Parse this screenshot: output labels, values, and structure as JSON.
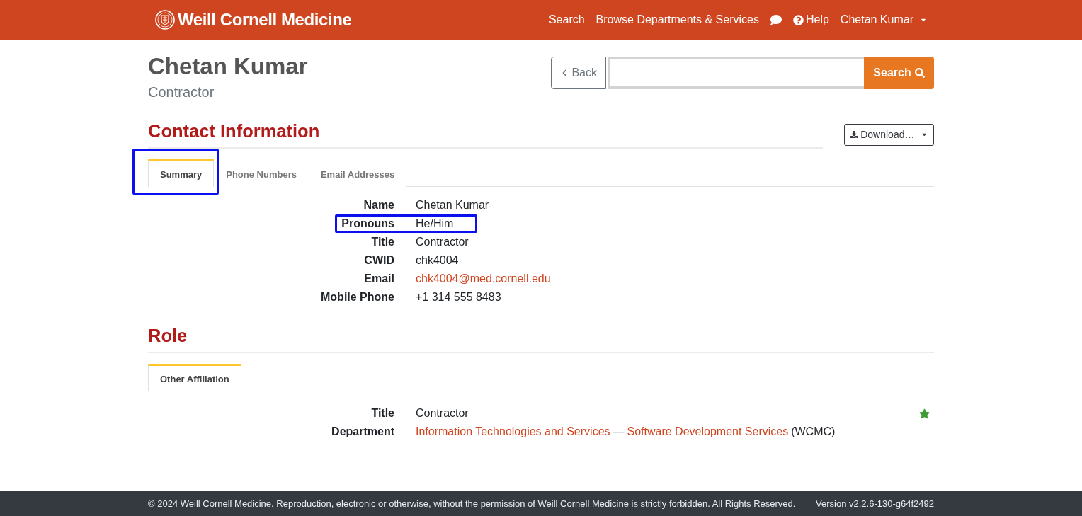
{
  "navbar": {
    "brand": "Weill Cornell Medicine",
    "items": [
      {
        "kind": "link",
        "label": "Search"
      },
      {
        "kind": "link",
        "label": "Browse Departments & Services"
      },
      {
        "kind": "chat"
      },
      {
        "kind": "help",
        "label": "Help"
      },
      {
        "kind": "user",
        "label": "Chetan Kumar"
      }
    ]
  },
  "profile": {
    "name": "Chetan Kumar",
    "title": "Contractor"
  },
  "search": {
    "back_label": "Back",
    "button_label": "Search"
  },
  "contact": {
    "heading": "Contact Information",
    "download_label": "Download…",
    "tabs": [
      {
        "label": "Summary",
        "selected": true,
        "highlighted": true
      },
      {
        "label": "Phone Numbers",
        "selected": false,
        "highlighted": false
      },
      {
        "label": "Email Addresses",
        "selected": false,
        "highlighted": false
      }
    ],
    "rows": [
      {
        "label": "Name",
        "value": "Chetan Kumar",
        "kind": "text",
        "highlighted": false
      },
      {
        "label": "Pronouns",
        "value": "He/Him",
        "kind": "text",
        "highlighted": true
      },
      {
        "label": "Title",
        "value": "Contractor",
        "kind": "text",
        "highlighted": false
      },
      {
        "label": "CWID",
        "value": "chk4004",
        "kind": "text",
        "highlighted": false
      },
      {
        "label": "Email",
        "value": "chk4004@med.cornell.edu",
        "kind": "link",
        "highlighted": false
      },
      {
        "label": "Mobile Phone",
        "value": "+1 314 555 8483",
        "kind": "text",
        "highlighted": false
      }
    ]
  },
  "role": {
    "heading": "Role",
    "tabs": [
      {
        "label": "Other Affiliation",
        "selected": true
      }
    ],
    "rows": [
      {
        "label": "Title",
        "starred": true,
        "parts": [
          {
            "kind": "text",
            "text": "Contractor"
          }
        ]
      },
      {
        "label": "Department",
        "starred": false,
        "parts": [
          {
            "kind": "link",
            "text": "Information Technologies and Services"
          },
          {
            "kind": "text",
            "text": "—"
          },
          {
            "kind": "link",
            "text": "Software Development Services"
          },
          {
            "kind": "text",
            "text": "(WCMC)"
          }
        ]
      }
    ]
  },
  "footer": {
    "copyright": "© 2024 Weill Cornell Medicine. Reproduction, electronic or otherwise, without the permission of Weill Cornell Medicine is strictly forbidden. All Rights Reserved.",
    "version": "Version v2.2.6-130-g64f2492"
  }
}
